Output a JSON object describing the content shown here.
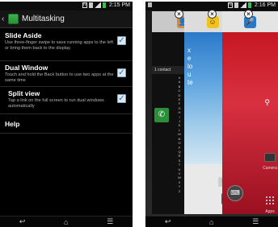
{
  "left_screen": {
    "status": {
      "time": "2:15 PM"
    },
    "title": "Multitasking",
    "settings": [
      {
        "title": "Slide Aside",
        "description": "Use three-finger swipe to save running apps to the left or bring them back to the display.",
        "checked": true
      },
      {
        "title": "Dual Window",
        "description": "Touch and hold the Back button to use two apps at the same time",
        "checked": true
      },
      {
        "title": "Split view",
        "description": "Tap a link on the full screen to run dual windows automatically",
        "checked": true
      },
      {
        "title": "Help"
      }
    ],
    "nav": {
      "back": "↩",
      "home": "⌂",
      "menu": "☰"
    }
  },
  "right_screen": {
    "status": {
      "time": "2:16 PM"
    },
    "contacts_card": {
      "contact_count": "1 contact",
      "alphabet": [
        "#",
        "A",
        "B",
        "C",
        "D",
        "E",
        "F",
        "G",
        "H",
        "I",
        "J",
        "K",
        "L",
        "M",
        "N",
        "O",
        "P",
        "Q",
        "R",
        "S",
        "T",
        "U",
        "V",
        "W",
        "X",
        "Y",
        "Z"
      ]
    },
    "messaging_card": {
      "image_text": "x\ne\nlo\nu\nte",
      "char_count": "160",
      "send_label": "Send"
    },
    "side_tiles": {
      "camera_label": "Camera",
      "apps_label": "Apps"
    },
    "nav": {
      "back": "↩",
      "home": "⌂",
      "menu": "☰"
    }
  }
}
